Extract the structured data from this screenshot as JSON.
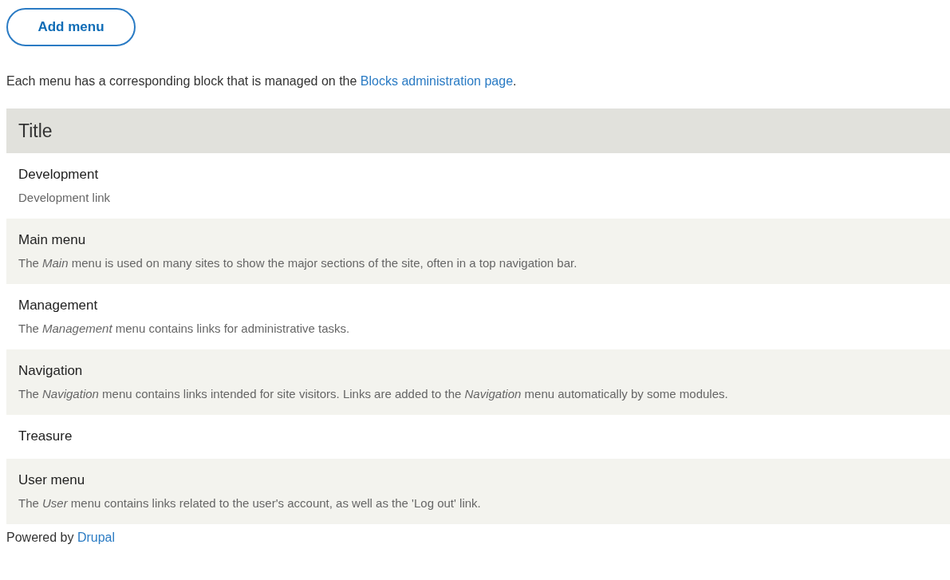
{
  "add_button": {
    "label": "Add menu"
  },
  "intro": {
    "before": "Each menu has a corresponding block that is managed on the ",
    "link": "Blocks administration page",
    "after": "."
  },
  "table": {
    "columns": [
      "Title"
    ],
    "rows": [
      {
        "title": "Development",
        "description": "Development link"
      },
      {
        "title": "Main menu",
        "description": "The *Main* menu is used on many sites to show the major sections of the site, often in a top navigation bar."
      },
      {
        "title": "Management",
        "description": "The *Management* menu contains links for administrative tasks."
      },
      {
        "title": "Navigation",
        "description": "The *Navigation* menu contains links intended for site visitors. Links are added to the *Navigation* menu automatically by some modules."
      },
      {
        "title": "Treasure"
      },
      {
        "title": "User menu",
        "description": "The *User* menu contains links related to the user's account, as well as the 'Log out' link."
      }
    ]
  },
  "footer": {
    "before": "Powered by ",
    "link": "Drupal"
  }
}
